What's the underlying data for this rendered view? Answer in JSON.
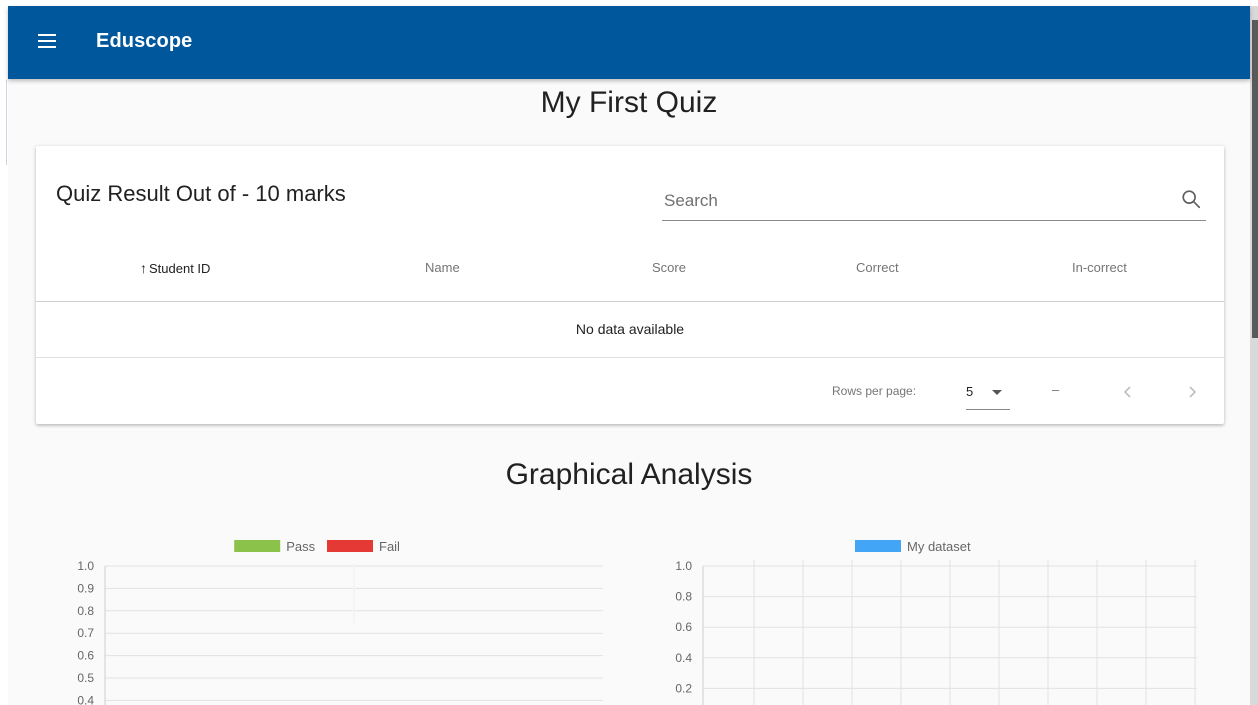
{
  "app": {
    "title": "Eduscope"
  },
  "page": {
    "title": "My First Quiz",
    "section_title": "Graphical Analysis"
  },
  "table_card": {
    "title": "Quiz Result Out of - 10 marks",
    "search": {
      "placeholder": "Search",
      "value": ""
    },
    "columns": [
      "Student ID",
      "Name",
      "Score",
      "Correct",
      "In-correct"
    ],
    "sorted_column": "Student ID",
    "sort_arrow": "↑",
    "empty_text": "No data available",
    "footer": {
      "rows_per_page_label": "Rows per page:",
      "rows_per_page_value": "5",
      "page_info": "–"
    }
  },
  "icons": [
    "menu-icon",
    "search-icon",
    "dropdown-caret-icon",
    "chevron-left-icon",
    "chevron-right-icon"
  ],
  "colors": {
    "app_bar": "#01579b",
    "pass": "#8bc34a",
    "fail": "#e53935",
    "dataset": "#42a5f5"
  },
  "chart_data": [
    {
      "type": "bar",
      "legend": [
        {
          "name": "Pass",
          "color": "#8bc34a"
        },
        {
          "name": "Fail",
          "color": "#e53935"
        }
      ],
      "series": [
        {
          "name": "Pass",
          "values": []
        },
        {
          "name": "Fail",
          "values": []
        }
      ],
      "y_ticks": [
        "1.0",
        "0.9",
        "0.8",
        "0.7",
        "0.6",
        "0.5",
        "0.4"
      ],
      "ylim": [
        0,
        1.0
      ],
      "grid": true,
      "legend_position": "top"
    },
    {
      "type": "line",
      "legend": [
        {
          "name": "My dataset",
          "color": "#42a5f5"
        }
      ],
      "series": [
        {
          "name": "My dataset",
          "values": []
        }
      ],
      "y_ticks": [
        "1.0",
        "0.8",
        "0.6",
        "0.4",
        "0.2"
      ],
      "ylim": [
        0,
        1.0
      ],
      "grid": true,
      "legend_position": "top"
    }
  ]
}
